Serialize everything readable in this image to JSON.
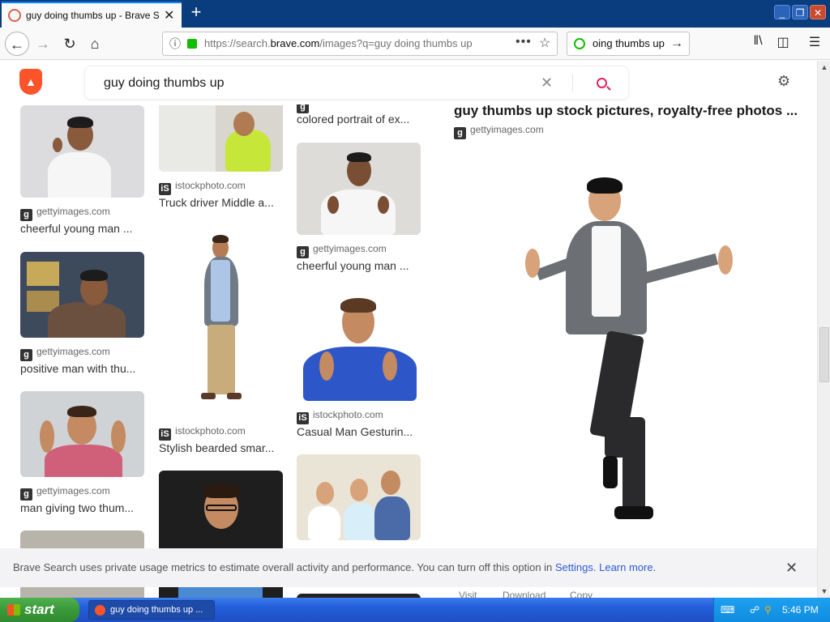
{
  "browser": {
    "tab_title": "guy doing thumbs up - Brave Search",
    "tab_close": "✕",
    "new_tab": "+",
    "url_prefix": "https://search.",
    "url_domain": "brave.com",
    "url_path": "/images?q=guy doing thumbs up",
    "search_box_value": "oing thumbs up",
    "window_buttons": [
      "_",
      "❐",
      "✕"
    ]
  },
  "page": {
    "query": "guy doing thumbs up",
    "results": {
      "col1": [
        {
          "source": "gettyimages.com",
          "caption": "cheerful young man ..."
        },
        {
          "source": "gettyimages.com",
          "caption": "positive man with thu..."
        },
        {
          "source": "gettyimages.com",
          "caption": "man giving two thum..."
        }
      ],
      "col2": [
        {
          "source": "istockphoto.com",
          "caption": "Truck driver Middle a..."
        },
        {
          "source": "istockphoto.com",
          "caption": "Stylish bearded smar..."
        }
      ],
      "col3": [
        {
          "source": "gettyimages.com",
          "caption": "colored portrait of ex..."
        },
        {
          "source": "gettyimages.com",
          "caption": "cheerful young man ..."
        },
        {
          "source": "istockphoto.com",
          "caption": "Casual Man Gesturin..."
        }
      ]
    },
    "preview": {
      "title": "guy thumbs up stock pictures, royalty-free photos ...",
      "source": "gettyimages.com",
      "actions": [
        "Visit",
        "Download",
        "Copy"
      ]
    },
    "notice": {
      "text": "Brave Search uses private usage metrics to estimate overall activity and performance. You can turn off this option in ",
      "settings_link": "Settings.",
      "learn_more_link": "Learn more.",
      "close": "✕"
    }
  },
  "taskbar": {
    "start_label": "start",
    "task_label": "guy doing thumbs up ...",
    "clock": "5:46 PM"
  },
  "colors": {
    "brand": "#fb542b",
    "accent": "#e0245e",
    "link": "#2d58d6",
    "titlebar": "#0a3d7e"
  }
}
